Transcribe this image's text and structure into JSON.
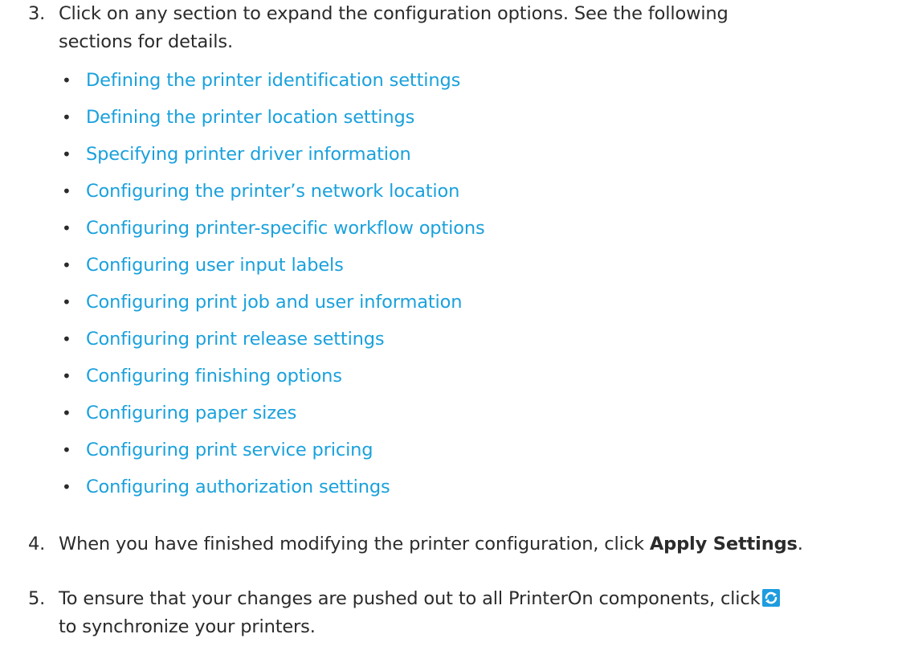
{
  "step3": {
    "number": "3.",
    "line1": "Click on any section to expand the configuration options. See the following",
    "line2": "sections for details."
  },
  "links": [
    "Defining the printer identification settings",
    "Defining the printer location settings",
    "Specifying printer driver information",
    "Configuring the printer’s network location",
    "Configuring printer-specific workflow options",
    "Configuring user input labels",
    "Configuring print job and user information",
    "Configuring print release settings",
    "Configuring finishing options",
    "Configuring paper sizes",
    "Configuring print service pricing",
    "Configuring authorization settings"
  ],
  "bullet": "•",
  "step4": {
    "number": "4.",
    "text_before": "When you have finished modifying the printer configuration, click ",
    "bold": "Apply Settings",
    "text_after": "."
  },
  "step5": {
    "number": "5.",
    "line1": "To ensure that your changes are pushed out to all PrinterOn components, click",
    "icon": "sync-icon",
    "line2": "to synchronize your printers."
  },
  "colors": {
    "text": "#2b2b2b",
    "link": "#1aa1dc",
    "icon_bg": "#1e9ce0"
  }
}
